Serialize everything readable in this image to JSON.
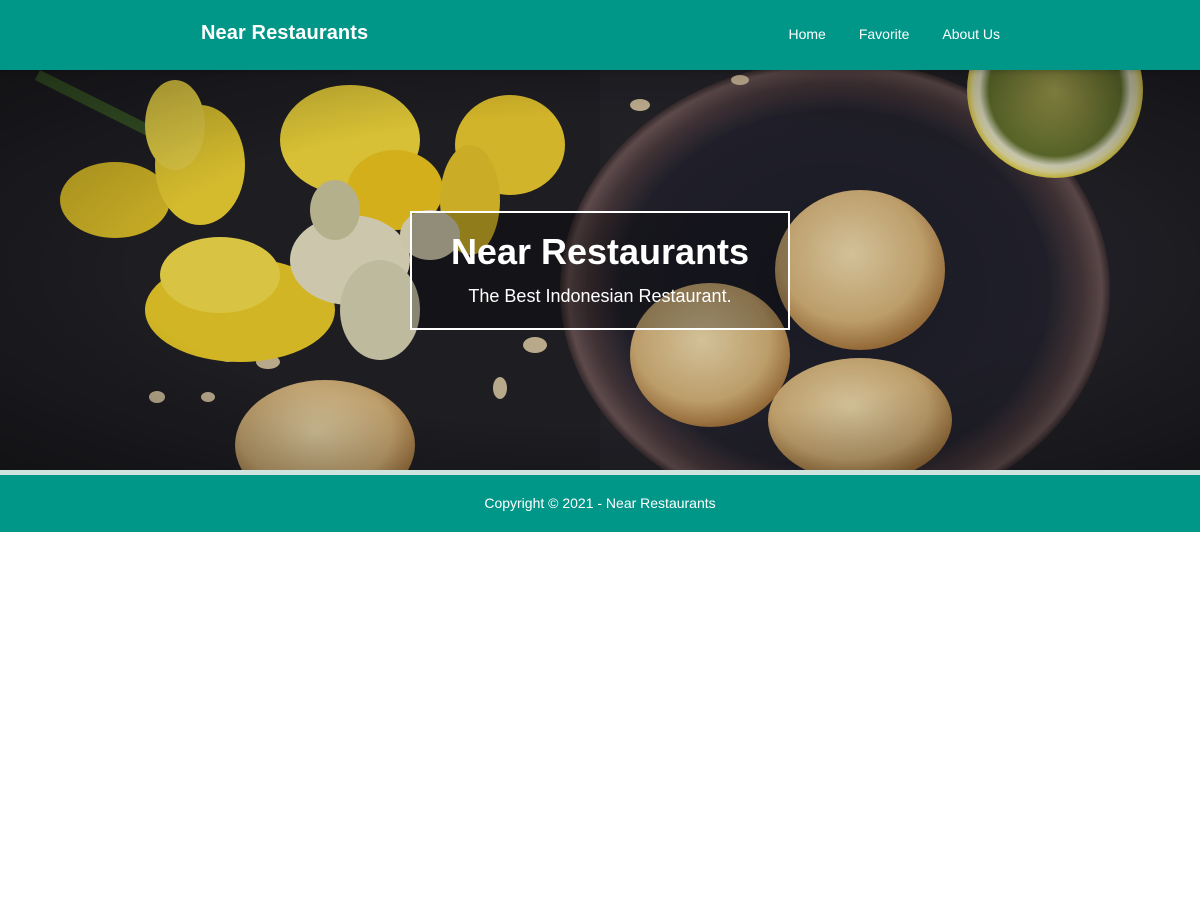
{
  "navbar": {
    "brand": "Near Restaurants",
    "links": [
      "Home",
      "Favorite",
      "About Us"
    ]
  },
  "hero": {
    "title": "Near Restaurants",
    "subtitle": "The Best Indonesian Restaurant."
  },
  "footer": {
    "copyright": "Copyright © 2021 - Near Restaurants"
  },
  "colors": {
    "primary": "#009688",
    "hero_background": "#232328",
    "divider": "#cfe3df"
  }
}
